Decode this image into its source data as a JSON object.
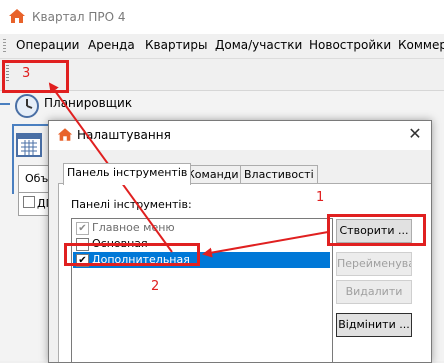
{
  "window": {
    "title": "Квартал ПРО 4"
  },
  "menu": {
    "items": [
      "Операции",
      "Аренда",
      "Квартиры",
      "Дома/участки",
      "Новостройки",
      "Коммер"
    ]
  },
  "workspace": {
    "planner_label": "Планировщик",
    "tab_label": "Объ",
    "list_header": "ДП"
  },
  "dialog": {
    "title": "Налаштування",
    "tabs": [
      "Панель інструментів",
      "Команди",
      "Властивості"
    ],
    "active_tab": "Панель інструментів",
    "panels_label": "Панелі інструментів:",
    "toolbars": [
      {
        "label": "Главное меню",
        "checked": true,
        "state": "disabled"
      },
      {
        "label": "Основная",
        "checked": false,
        "state": "normal"
      },
      {
        "label": "Дополнительная",
        "checked": true,
        "state": "selected"
      }
    ],
    "buttons": {
      "create": "Створити ...",
      "rename": "Перейменувати",
      "delete": "Видалити",
      "reset": "Відмінити ..."
    }
  },
  "annotations": {
    "one": "1",
    "two": "2",
    "three": "3"
  },
  "colors": {
    "annotation": "#e02020",
    "selection": "#0078d7",
    "brand": "#e8622a",
    "accent_bar": "#4a7fc0"
  },
  "icons": {
    "app": "house-icon",
    "planner": "clock-icon",
    "calendar": "calendar-icon",
    "dialog": "house-icon",
    "close": "close-icon",
    "checkbox": "check-icon"
  }
}
